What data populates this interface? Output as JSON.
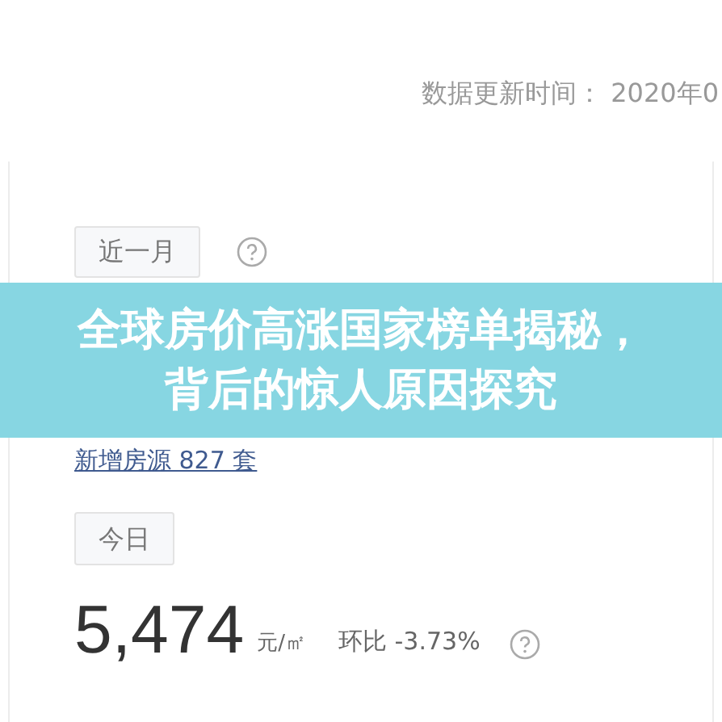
{
  "update_time": "数据更新时间： 2020年0",
  "sections": [
    {
      "tab": "近一月",
      "new_listings": "新增房源 827 套"
    },
    {
      "tab": "今日",
      "price": "5,474",
      "unit": "元/㎡",
      "change": "环比 -3.73%"
    }
  ],
  "banner": {
    "title": "全球房价高涨国家榜单揭秘，背后的惊人原因探究"
  }
}
